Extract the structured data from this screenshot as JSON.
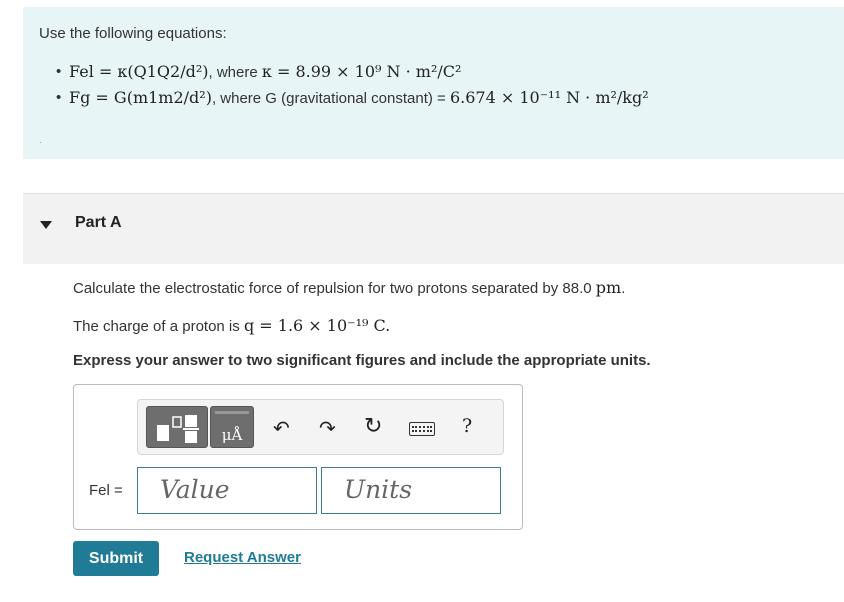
{
  "intro": {
    "text": "Use the following equations:",
    "equations": [
      {
        "formula": "Fel = κ(Q1Q2/d²)",
        "where": ", where ",
        "constant": "κ = 8.99 × 10⁹ N · m²/C²"
      },
      {
        "formula": "Fg = G(m1m2/d²)",
        "where": ", where G (gravitational constant) = ",
        "constant": "6.674 × 10⁻¹¹ N · m²/kg²"
      }
    ],
    "small_mark": "·"
  },
  "part": {
    "title": "Part A",
    "question": "Calculate the electrostatic force of repulsion for two protons separated by 88.0 ",
    "question_unit": "pm",
    "question_end": ".",
    "charge_prefix": "The charge of a proton is ",
    "charge_value": "q = 1.6 × 10⁻¹⁹ C.",
    "instruction": "Express your answer to two significant figures and include the appropriate units."
  },
  "answer": {
    "toolbar": {
      "templates_icon": "templates-icon",
      "units_label": "μÅ",
      "undo_glyph": "↶",
      "redo_glyph": "↷",
      "reset_glyph": "↻",
      "help_glyph": "?"
    },
    "label": "Fel =",
    "value_placeholder": "Value",
    "units_placeholder": "Units"
  },
  "actions": {
    "submit_label": "Submit",
    "request_label": "Request Answer"
  },
  "colors": {
    "info_bg": "#e8f5f7",
    "accent": "#1f7b96",
    "field_border": "#3c7e8a"
  }
}
